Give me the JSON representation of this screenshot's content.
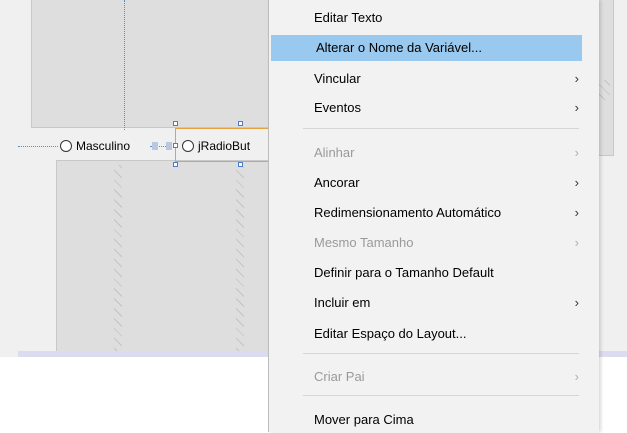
{
  "designer": {
    "radio_masculino": "Masculino",
    "radio_selected": "jRadioBut"
  },
  "context_menu": {
    "items": [
      {
        "label": "Editar Texto",
        "enabled": true,
        "submenu": false
      },
      {
        "label": "Alterar o Nome da Variável...",
        "enabled": true,
        "submenu": false,
        "highlighted": true
      },
      {
        "label": "Vincular",
        "enabled": true,
        "submenu": true
      },
      {
        "label": "Eventos",
        "enabled": true,
        "submenu": true
      },
      {
        "label": "Alinhar",
        "enabled": false,
        "submenu": true
      },
      {
        "label": "Ancorar",
        "enabled": true,
        "submenu": true
      },
      {
        "label": "Redimensionamento Automático",
        "enabled": true,
        "submenu": true
      },
      {
        "label": "Mesmo Tamanho",
        "enabled": false,
        "submenu": true
      },
      {
        "label": "Definir para o Tamanho Default",
        "enabled": true,
        "submenu": false
      },
      {
        "label": "Incluir em",
        "enabled": true,
        "submenu": true
      },
      {
        "label": "Editar Espaço do Layout...",
        "enabled": true,
        "submenu": false
      },
      {
        "label": "Criar Pai",
        "enabled": false,
        "submenu": true
      },
      {
        "label": "Mover para Cima",
        "enabled": true,
        "submenu": false
      }
    ],
    "arrow_glyph": "›",
    "highlight_color": "#99c9ef"
  }
}
